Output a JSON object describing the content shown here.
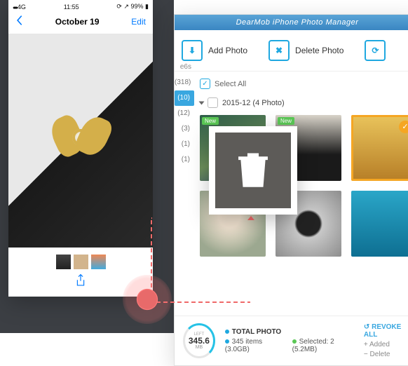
{
  "phone": {
    "carrier": "4G",
    "time": "11:55",
    "battery": "99%",
    "title": "October 19",
    "edit": "Edit"
  },
  "app": {
    "title": "DearMob iPhone Photo Manager",
    "toolbar": {
      "add": "Add Photo",
      "delete": "Delete Photo"
    },
    "sidebar": {
      "label_suffix": "e6s",
      "counts": [
        "(318)",
        "(10)",
        "(12)",
        "(3)",
        "(1)",
        "(1)"
      ]
    },
    "select_all": "Select All",
    "group": "2015-12 (4 Photo)",
    "badge_new": "New",
    "footer": {
      "gauge_label": "LEFT",
      "gauge_value": "345.6",
      "gauge_unit": "MB",
      "total_label": "TOTAL PHOTO",
      "total_items": "345 items (3.0GB)",
      "selected": "Selected: 2 (5.2MB)",
      "revoke": "REVOKE ALL",
      "added": "Added",
      "delete": "Delete"
    }
  }
}
